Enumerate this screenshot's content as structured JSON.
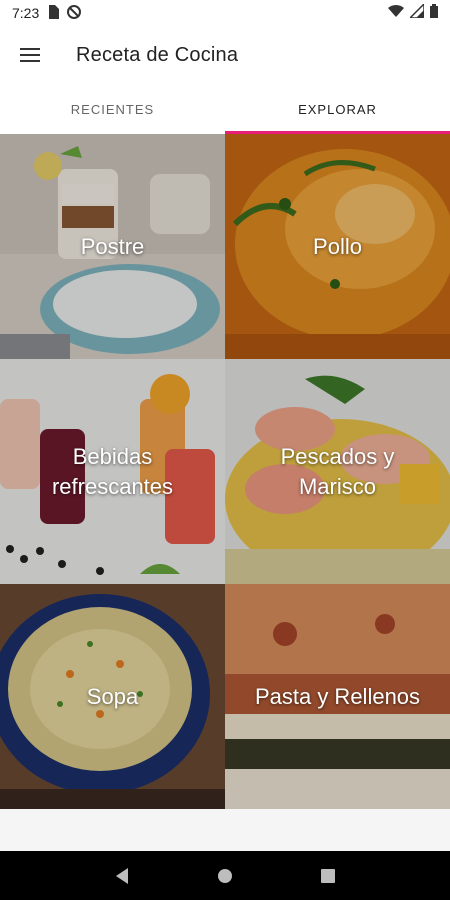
{
  "status": {
    "time": "7:23",
    "icons": [
      "sim-card-icon",
      "do-not-disturb-icon",
      "wifi-icon",
      "cell-signal-icon",
      "battery-icon"
    ]
  },
  "app": {
    "title": "Receta de Cocina",
    "menu_icon": "hamburger-menu-icon"
  },
  "tabs": [
    {
      "label": "RECIENTES",
      "active": false
    },
    {
      "label": "EXPLORAR",
      "active": true
    }
  ],
  "categories": [
    {
      "label": "Postre"
    },
    {
      "label": "Pollo"
    },
    {
      "label": "Bebidas\nrefrescantes"
    },
    {
      "label": "Pescados y\nMarisco"
    },
    {
      "label": "Sopa"
    },
    {
      "label": "Pasta y Rellenos"
    }
  ],
  "nav": {
    "icons": [
      "back-icon",
      "home-icon",
      "recents-icon"
    ]
  },
  "colors": {
    "tab_indicator": "#e91e78",
    "nav_bar": "#000000"
  }
}
